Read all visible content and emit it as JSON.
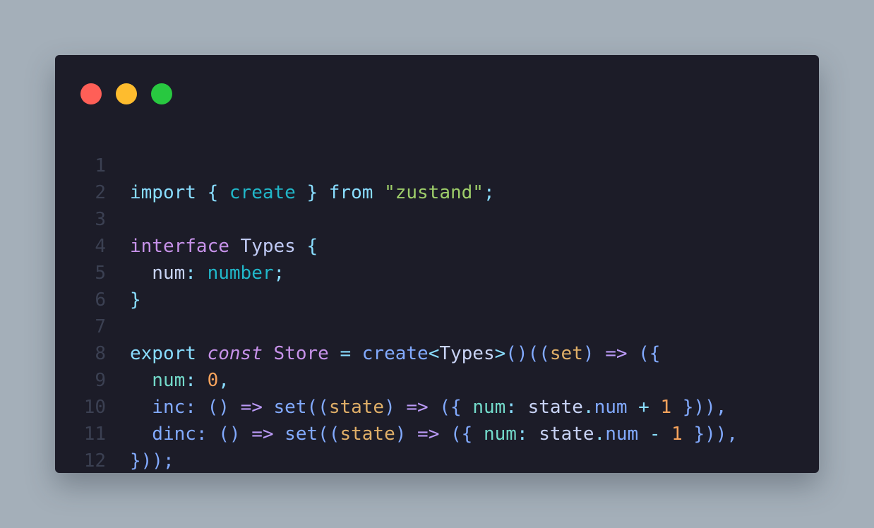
{
  "window": {
    "buttons": [
      {
        "name": "close",
        "color": "#ff5f57"
      },
      {
        "name": "minimize",
        "color": "#febc2e"
      },
      {
        "name": "maximize",
        "color": "#28c840"
      }
    ]
  },
  "line_numbers": [
    "1",
    "2",
    "3",
    "4",
    "5",
    "6",
    "7",
    "8",
    "9",
    "10",
    "11",
    "12"
  ],
  "code": {
    "l1": [
      "import",
      " { ",
      "create",
      " } ",
      "from",
      " ",
      "\"zustand\"",
      ";"
    ],
    "l3": [
      "interface",
      " ",
      "Types",
      " {"
    ],
    "l4": [
      "  num",
      ": ",
      "number",
      ";"
    ],
    "l5": [
      "}"
    ],
    "l7": [
      "export",
      " ",
      "const",
      " ",
      "Store",
      " = ",
      "create",
      "<",
      "Types",
      ">",
      "()((",
      "set",
      ") ",
      "=>",
      " ({"
    ],
    "l8": [
      "  num",
      ": ",
      "0",
      ","
    ],
    "l9": [
      "  inc",
      ": () ",
      "=>",
      " ",
      "set",
      "((",
      "state",
      ") ",
      "=>",
      " ({ ",
      "num",
      ": ",
      "state",
      ".",
      "num",
      " + ",
      "1",
      " })),"
    ],
    "l10": [
      "  dinc",
      ": () ",
      "=>",
      " ",
      "set",
      "((",
      "state",
      ") ",
      "=>",
      " ({ ",
      "num",
      ": ",
      "state",
      ".",
      "num",
      " - ",
      "1",
      " })),"
    ],
    "l11": [
      "}));"
    ]
  }
}
